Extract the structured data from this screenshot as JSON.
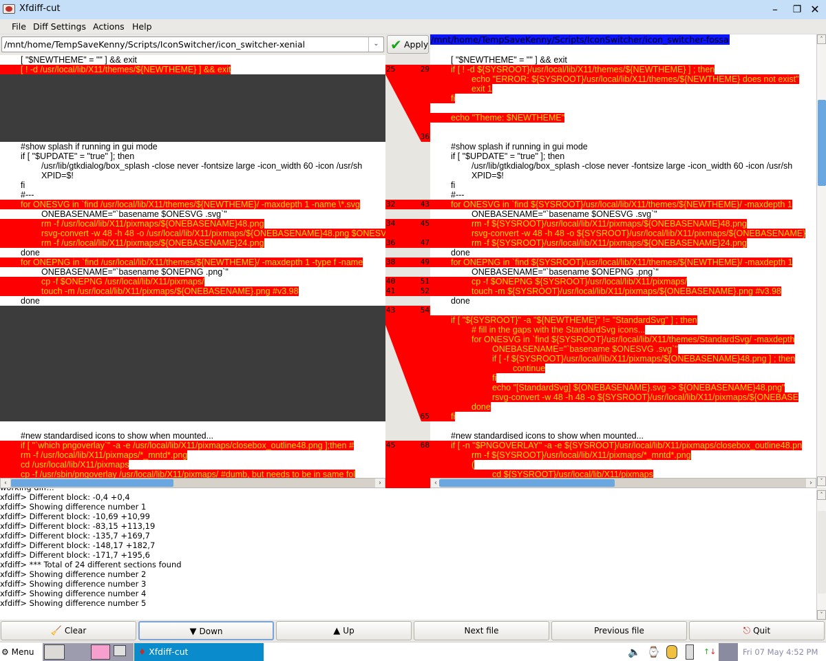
{
  "window": {
    "title": "Xfdiff-cut",
    "controls": [
      "minimize-icon",
      "maximize-icon",
      "close-icon"
    ]
  },
  "menu": [
    "File",
    "Diff Settings",
    "Actions",
    "Help"
  ],
  "left_file": {
    "path": "/mnt/home/TempSaveKenny/Scripts/IconSwitcher/icon_switcher-xenial"
  },
  "apply_label": "Apply",
  "right_file": {
    "path": "/mnt/home/TempSaveKenny/Scripts/IconSwitcher/icon_switcher-fossa"
  },
  "colors": {
    "diff_bg": "#ff0000",
    "diff_text": "#ffd400",
    "gap": "#3c3c3c",
    "path_highlight": "#0a14ff"
  },
  "left_lines": [
    {
      "type": "same",
      "indent": 1,
      "text": "[ \"$NEWTHEME\" = \"\" ] && exit"
    },
    {
      "type": "diff",
      "indent": 1,
      "text": "[ ! -d /usr/local/lib/X11/themes/${NEWTHEME} ] && exit"
    },
    {
      "type": "gap"
    },
    {
      "type": "gap"
    },
    {
      "type": "gap"
    },
    {
      "type": "gap"
    },
    {
      "type": "gap"
    },
    {
      "type": "gap"
    },
    {
      "type": "gap"
    },
    {
      "type": "same",
      "indent": 1,
      "text": "#show splash if running in gui mode"
    },
    {
      "type": "same",
      "indent": 1,
      "text": "if [ \"$UPDATE\" = \"true\" ]; then"
    },
    {
      "type": "same",
      "indent": 2,
      "text": "/usr/lib/gtkdialog/box_splash -close never -fontsize large -icon_width 60 -icon /usr/sh"
    },
    {
      "type": "same",
      "indent": 2,
      "text": "XPID=$!"
    },
    {
      "type": "same",
      "indent": 1,
      "text": "fi"
    },
    {
      "type": "same",
      "indent": 1,
      "text": "#---"
    },
    {
      "type": "diff",
      "indent": 1,
      "text": "for ONESVG in `find /usr/local/lib/X11/themes/${NEWTHEME}/ -maxdepth 1 -name \\*.svg"
    },
    {
      "type": "same",
      "indent": 2,
      "text": "ONEBASENAME=\"`basename $ONESVG .svg`\""
    },
    {
      "type": "diff",
      "indent": 2,
      "text": "rm -f /usr/local/lib/X11/pixmaps/${ONEBASENAME}48.png"
    },
    {
      "type": "diff",
      "indent": 2,
      "text": "rsvg-convert -w 48 -h 48 -o /usr/local/lib/X11/pixmaps/${ONEBASENAME}48.png $ONESVG"
    },
    {
      "type": "diff",
      "indent": 2,
      "text": "rm -f /usr/local/lib/X11/pixmaps/${ONEBASENAME}24.png"
    },
    {
      "type": "same",
      "indent": 1,
      "text": "done"
    },
    {
      "type": "diff",
      "indent": 1,
      "text": "for ONEPNG in `find /usr/local/lib/X11/themes/${NEWTHEME}/ -maxdepth 1 -type f -name"
    },
    {
      "type": "same",
      "indent": 2,
      "text": "ONEBASENAME=\"`basename $ONEPNG .png`\""
    },
    {
      "type": "diff",
      "indent": 2,
      "text": "cp -f $ONEPNG /usr/local/lib/X11/pixmaps/"
    },
    {
      "type": "diff",
      "indent": 2,
      "text": "touch -m /usr/local/lib/X11/pixmaps/${ONEBASENAME}.png #v3.98"
    },
    {
      "type": "same",
      "indent": 1,
      "text": "done"
    },
    {
      "type": "gap"
    },
    {
      "type": "gap"
    },
    {
      "type": "gap"
    },
    {
      "type": "gap"
    },
    {
      "type": "gap"
    },
    {
      "type": "gap"
    },
    {
      "type": "gap"
    },
    {
      "type": "gap"
    },
    {
      "type": "gap"
    },
    {
      "type": "gap"
    },
    {
      "type": "gap"
    },
    {
      "type": "gap"
    },
    {
      "type": "blank"
    },
    {
      "type": "same",
      "indent": 1,
      "text": "#new standardised icons to show when mounted..."
    },
    {
      "type": "diff",
      "indent": 1,
      "text": "if [ \"`which pngoverlay`\" -a -e /usr/local/lib/X11/pixmaps/closebox_outline48.png ];then #"
    },
    {
      "type": "diff",
      "indent": 1,
      "text": "rm -f /usr/local/lib/X11/pixmaps/*_mntd*.png"
    },
    {
      "type": "diff",
      "indent": 1,
      "text": "cd /usr/local/lib/X11/pixmaps"
    },
    {
      "type": "diff",
      "indent": 1,
      "text": "cp -f /usr/sbin/pngoverlay /usr/local/lib/X11/pixmaps/ #dumb, but needs to be in same fol"
    }
  ],
  "right_lines": [
    {
      "type": "same",
      "indent": 1,
      "text": "[ \"$NEWTHEME\" = \"\" ] && exit"
    },
    {
      "type": "diff",
      "indent": 1,
      "text": "if [ ! -d ${SYSROOT}/usr/local/lib/X11/themes/${NEWTHEME} ] ; then"
    },
    {
      "type": "diff",
      "indent": 2,
      "text": "echo \"ERROR: ${SYSROOT}/usr/local/lib/X11/themes/${NEWTHEME} does not exist\""
    },
    {
      "type": "diff",
      "indent": 2,
      "text": "exit 1"
    },
    {
      "type": "diff",
      "indent": 1,
      "text": "fi"
    },
    {
      "type": "blank"
    },
    {
      "type": "diff",
      "indent": 1,
      "text": "echo \"Theme: $NEWTHEME\""
    },
    {
      "type": "blank"
    },
    {
      "type": "blank"
    },
    {
      "type": "same",
      "indent": 1,
      "text": "#show splash if running in gui mode"
    },
    {
      "type": "same",
      "indent": 1,
      "text": "if [ \"$UPDATE\" = \"true\" ]; then"
    },
    {
      "type": "same",
      "indent": 2,
      "text": "/usr/lib/gtkdialog/box_splash -close never -fontsize large -icon_width 60 -icon /usr/sh"
    },
    {
      "type": "same",
      "indent": 2,
      "text": "XPID=$!"
    },
    {
      "type": "same",
      "indent": 1,
      "text": "fi"
    },
    {
      "type": "same",
      "indent": 1,
      "text": "#---"
    },
    {
      "type": "diff",
      "indent": 1,
      "text": "for ONESVG in `find ${SYSROOT}/usr/local/lib/X11/themes/${NEWTHEME}/ -maxdepth 1"
    },
    {
      "type": "same",
      "indent": 2,
      "text": "ONEBASENAME=\"`basename $ONESVG .svg`\""
    },
    {
      "type": "diff",
      "indent": 2,
      "text": "rm -f ${SYSROOT}/usr/local/lib/X11/pixmaps/${ONEBASENAME}48.png"
    },
    {
      "type": "diff",
      "indent": 2,
      "text": "rsvg-convert -w 48 -h 48 -o ${SYSROOT}/usr/local/lib/X11/pixmaps/${ONEBASENAME}"
    },
    {
      "type": "diff",
      "indent": 2,
      "text": "rm -f ${SYSROOT}/usr/local/lib/X11/pixmaps/${ONEBASENAME}24.png"
    },
    {
      "type": "same",
      "indent": 1,
      "text": "done"
    },
    {
      "type": "diff",
      "indent": 1,
      "text": "for ONEPNG in `find ${SYSROOT}/usr/local/lib/X11/themes/${NEWTHEME}/ -maxdepth 1"
    },
    {
      "type": "same",
      "indent": 2,
      "text": "ONEBASENAME=\"`basename $ONEPNG .png`\""
    },
    {
      "type": "diff",
      "indent": 2,
      "text": "cp -f $ONEPNG ${SYSROOT}/usr/local/lib/X11/pixmaps/"
    },
    {
      "type": "diff",
      "indent": 2,
      "text": "touch -m ${SYSROOT}/usr/local/lib/X11/pixmaps/${ONEBASENAME}.png #v3.98"
    },
    {
      "type": "same",
      "indent": 1,
      "text": "done"
    },
    {
      "type": "blank"
    },
    {
      "type": "diff",
      "indent": 1,
      "text": "if [ \"${SYSROOT}\" -a \"${NEWTHEME}\" != \"StandardSvg\" ] ; then"
    },
    {
      "type": "diff",
      "indent": 2,
      "text": "# fill in the gaps with the StandardSvg icons..."
    },
    {
      "type": "diff",
      "indent": 2,
      "text": "for ONESVG in `find ${SYSROOT}/usr/local/lib/X11/themes/StandardSvg/ -maxdepth"
    },
    {
      "type": "diff",
      "indent": 3,
      "text": "ONEBASENAME=\"`basename $ONESVG .svg`\""
    },
    {
      "type": "diff",
      "indent": 3,
      "text": "if [ -f ${SYSROOT}/usr/local/lib/X11/pixmaps/${ONEBASENAME}48.png ] ; then"
    },
    {
      "type": "diff",
      "indent": 4,
      "text": "continue"
    },
    {
      "type": "diff",
      "indent": 3,
      "text": "fi"
    },
    {
      "type": "diff",
      "indent": 3,
      "text": "echo \"[StandardSvg] ${ONEBASENAME}.svg -> ${ONEBASENAME}48.png\""
    },
    {
      "type": "diff",
      "indent": 3,
      "text": "rsvg-convert -w 48 -h 48 -o ${SYSROOT}/usr/local/lib/X11/pixmaps/${ONEBASE"
    },
    {
      "type": "diff",
      "indent": 2,
      "text": "done"
    },
    {
      "type": "diff",
      "indent": 1,
      "text": "fi"
    },
    {
      "type": "blank"
    },
    {
      "type": "same",
      "indent": 1,
      "text": "#new standardised icons to show when mounted..."
    },
    {
      "type": "diff",
      "indent": 1,
      "text": "if [ -n \"$PNGOVERLAY\" -a -e ${SYSROOT}/usr/local/lib/X11/pixmaps/closebox_outline48.pn"
    },
    {
      "type": "diff",
      "indent": 2,
      "text": "rm -f ${SYSROOT}/usr/local/lib/X11/pixmaps/*_mntd*.png"
    },
    {
      "type": "diff",
      "indent": 2,
      "text": "("
    },
    {
      "type": "diff",
      "indent": 3,
      "text": "cd ${SYSROOT}/usr/local/lib/X11/pixmaps"
    }
  ],
  "gutter_numbers": [
    {
      "row": 1,
      "left": "25",
      "right": "29"
    },
    {
      "row": 8,
      "left": "",
      "right": "36"
    },
    {
      "row": 15,
      "left": "32",
      "right": "43"
    },
    {
      "row": 17,
      "left": "34",
      "right": "45"
    },
    {
      "row": 19,
      "left": "36",
      "right": "47"
    },
    {
      "row": 21,
      "left": "38",
      "right": "49"
    },
    {
      "row": 23,
      "left": "40",
      "right": "51"
    },
    {
      "row": 24,
      "left": "41",
      "right": "52"
    },
    {
      "row": 26,
      "left": "43",
      "right": "54"
    },
    {
      "row": 37,
      "left": "",
      "right": "65"
    },
    {
      "row": 40,
      "left": "45",
      "right": "68"
    }
  ],
  "log": [
    "working diff...",
    "xfdiff> Different block: -0,4 +0,4",
    "xfdiff> Showing difference number 1",
    "xfdiff> Different block: -10,69 +10,99",
    "xfdiff> Different block: -83,15 +113,19",
    "xfdiff> Different block: -135,7 +169,7",
    "xfdiff> Different block: -148,17 +182,7",
    "xfdiff> Different block: -171,7 +195,6",
    "xfdiff> *** Total of 24 different sections found",
    "xfdiff> Showing difference number 2",
    "xfdiff> Showing difference number 3",
    "xfdiff> Showing difference number 4",
    "xfdiff> Showing difference number 5"
  ],
  "buttons": {
    "clear": "Clear",
    "down": "Down",
    "up": "Up",
    "next_file": "Next file",
    "previous_file": "Previous file",
    "quit": "Quit"
  },
  "taskbar": {
    "menu": "Menu",
    "task": "Xfdiff-cut",
    "clock": "Fri 07 May  4:52 PM"
  }
}
